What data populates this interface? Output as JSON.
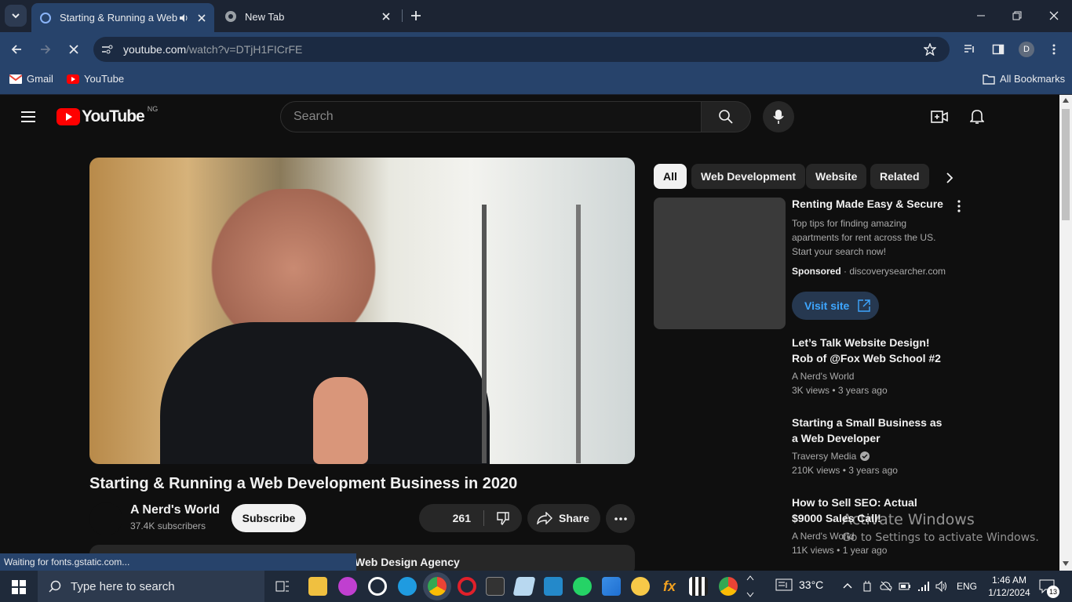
{
  "browser": {
    "tabs": [
      {
        "title": "Starting & Running a Web D",
        "active": true
      },
      {
        "title": "New Tab",
        "active": false
      }
    ],
    "url_host": "youtube.com",
    "url_path": "/watch?v=DTjH1FICrFE",
    "profile_initial": "D",
    "bookmarks": [
      {
        "label": "Gmail"
      },
      {
        "label": "YouTube"
      }
    ],
    "all_bookmarks": "All Bookmarks",
    "status_text": "Waiting for fonts.gstatic.com..."
  },
  "youtube": {
    "logo_text": "YouTube",
    "country": "NG",
    "search_placeholder": "Search",
    "video_title": "Starting & Running a Web Development Business in 2020",
    "channel_name": "A Nerd's World",
    "subscribers": "37.4K subscribers",
    "subscribe_label": "Subscribe",
    "likes": "261",
    "share_label": "Share",
    "description_peek": "Web Design Agency",
    "chips": [
      "All",
      "Web Development",
      "Website",
      "Related"
    ],
    "ad": {
      "title": "Renting Made Easy & Secure",
      "body": "Top tips for finding amazing apartments for rent across the US. Start your search now!",
      "sponsored": "Sponsored",
      "domain": "discoverysearcher.com",
      "cta": "Visit site"
    },
    "related": [
      {
        "title": "Let’s Talk Website Design! Rob of @Fox Web School #2",
        "channel": "A Nerd's World",
        "verified": false,
        "views": "3K views",
        "age": "3 years ago"
      },
      {
        "title": "Starting a Small Business as a Web Developer",
        "channel": "Traversy Media",
        "verified": true,
        "views": "210K views",
        "age": "3 years ago"
      },
      {
        "title": "How to Sell SEO: Actual $9000 Sales Call!",
        "channel": "A Nerd's World",
        "verified": false,
        "views": "11K views",
        "age": "1 year ago"
      }
    ]
  },
  "watermark": {
    "line1": "Activate Windows",
    "line2": "Go to Settings to activate Windows."
  },
  "taskbar": {
    "search_placeholder": "Type here to search",
    "weather": "33°C",
    "language": "ENG",
    "time": "1:46 AM",
    "date": "1/12/2024",
    "notifications": "13"
  }
}
